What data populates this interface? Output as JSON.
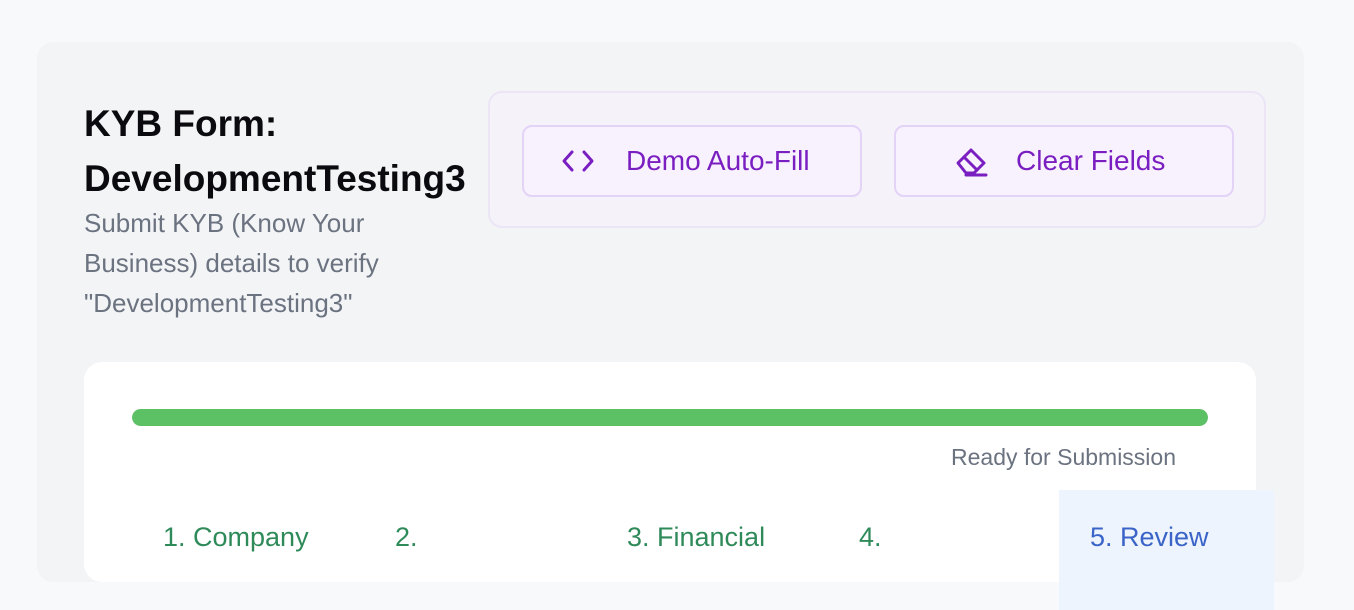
{
  "header": {
    "title": "KYB Form: DevelopmentTesting3",
    "subtitle": "Submit KYB (Know Your Business) details to verify \"DevelopmentTesting3\""
  },
  "actions": {
    "demo_autofill_label": "Demo Auto-Fill",
    "clear_fields_label": "Clear Fields"
  },
  "progress": {
    "value": 1.0,
    "status_text": "Ready for Submission"
  },
  "steps": [
    {
      "label": "1. Company"
    },
    {
      "label": "2."
    },
    {
      "label": "3. Financial"
    },
    {
      "label": "4."
    },
    {
      "label": "5. Review",
      "active": true
    }
  ],
  "colors": {
    "accent": "#7a1ec1",
    "progress_fill": "#5cc064",
    "step_done": "#2f8a5a",
    "step_active": "#3a64c8"
  }
}
